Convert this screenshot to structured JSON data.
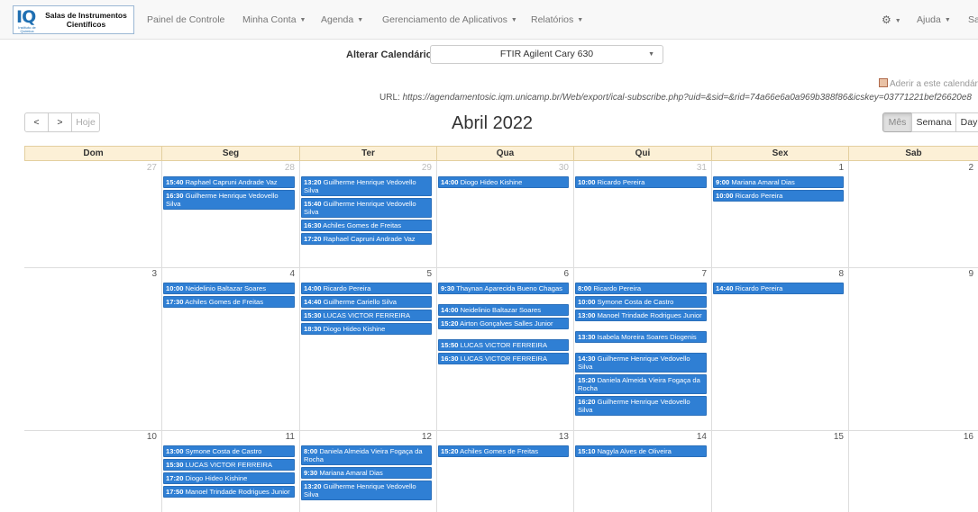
{
  "brand": {
    "title_line1": "Salas de Instrumentos",
    "title_line2": "Científicos",
    "logo_letters": "IQ",
    "logo_sub": "Instituto de Química"
  },
  "nav": {
    "items": [
      {
        "label": "Painel de Controle",
        "caret": false
      },
      {
        "label": "Minha Conta",
        "caret": true
      },
      {
        "label": "Agenda",
        "caret": true
      },
      {
        "label": "Gerenciamento de Aplicativos",
        "caret": true
      },
      {
        "label": "Relatórios",
        "caret": true
      }
    ],
    "help": "Ajuda",
    "right_cut": "Sa"
  },
  "controls": {
    "alter_label": "Alterar Calendário",
    "selected_calendar": "FTIR Agilent Cary 630",
    "subscribe_text": "Aderir a este calendár",
    "url_label": "URL:",
    "url": "https://agendamentosic.iqm.unicamp.br/Web/export/ical-subscribe.php?uid=&sid=&rid=74a66e6a0a969b388f86&icskey=03771221bef26620e8"
  },
  "toolbar": {
    "prev": "<",
    "next": ">",
    "today": "Hoje",
    "month_title": "Abril 2022",
    "views": [
      "Mês",
      "Semana",
      "Day"
    ]
  },
  "calendar": {
    "day_headers": [
      "Dom",
      "Seg",
      "Ter",
      "Qua",
      "Qui",
      "Sex",
      "Sab"
    ],
    "weeks": [
      {
        "days": [
          {
            "num": "27",
            "other": true,
            "events": []
          },
          {
            "num": "28",
            "other": true,
            "events": [
              {
                "time": "15:40",
                "name": "Raphael Capruni Andrade Vaz"
              },
              {
                "time": "16:30",
                "name": "Guilherme Henrique Vedovello Silva"
              }
            ]
          },
          {
            "num": "29",
            "other": true,
            "events": [
              {
                "time": "13:20",
                "name": "Guilherme Henrique Vedovello Silva"
              },
              {
                "time": "15:40",
                "name": "Guilherme Henrique Vedovello Silva"
              },
              {
                "time": "16:30",
                "name": "Achiles Gomes de Freitas"
              },
              {
                "time": "17:20",
                "name": "Raphael Capruni Andrade Vaz"
              }
            ]
          },
          {
            "num": "30",
            "other": true,
            "events": [
              {
                "time": "14:00",
                "name": "Diogo Hideo Kishine"
              }
            ]
          },
          {
            "num": "31",
            "other": true,
            "events": [
              {
                "time": "10:00",
                "name": "Ricardo Pereira"
              }
            ]
          },
          {
            "num": "1",
            "other": false,
            "events": [
              {
                "time": "9:00",
                "name": "Mariana Amaral Dias"
              },
              {
                "time": "10:00",
                "name": "Ricardo Pereira"
              }
            ]
          },
          {
            "num": "2",
            "other": false,
            "events": []
          }
        ]
      },
      {
        "days": [
          {
            "num": "3",
            "other": false,
            "events": []
          },
          {
            "num": "4",
            "other": false,
            "events": [
              {
                "time": "10:00",
                "name": "Neidelinio Baltazar Soares"
              },
              {
                "time": "17:30",
                "name": "Achiles Gomes de Freitas"
              }
            ]
          },
          {
            "num": "5",
            "other": false,
            "events": [
              {
                "time": "14:00",
                "name": "Ricardo Pereira"
              },
              {
                "time": "14:40",
                "name": "Guilherme Cariello Silva"
              },
              {
                "time": "15:30",
                "name": "LUCAS VICTOR FERREIRA"
              },
              {
                "time": "18:30",
                "name": "Diogo Hideo Kishine"
              }
            ]
          },
          {
            "num": "6",
            "other": false,
            "events": [
              {
                "time": "9:30",
                "name": "Thaynan Aparecida Bueno Chagas"
              },
              {
                "time": "14:00",
                "name": "Neidelinio Baltazar Soares"
              },
              {
                "time": "15:20",
                "name": "Airton Gonçalves Salles Junior"
              },
              {
                "time": "15:50",
                "name": "LUCAS VICTOR FERREIRA"
              },
              {
                "time": "16:30",
                "name": "LUCAS VICTOR FERREIRA"
              }
            ]
          },
          {
            "num": "7",
            "other": false,
            "events": [
              {
                "time": "8:00",
                "name": "Ricardo Pereira"
              },
              {
                "time": "10:00",
                "name": "Symone Costa de Castro"
              },
              {
                "time": "13:00",
                "name": "Manoel Trindade Rodrigues Junior"
              },
              {
                "time": "13:30",
                "name": "Isabela Moreira Soares Diogenis"
              },
              {
                "time": "14:30",
                "name": "Guilherme Henrique Vedovello Silva"
              },
              {
                "time": "15:20",
                "name": "Daniela Almeida Vieira Fogaça da Rocha"
              },
              {
                "time": "16:20",
                "name": "Guilherme Henrique Vedovello Silva"
              }
            ]
          },
          {
            "num": "8",
            "other": false,
            "events": [
              {
                "time": "14:40",
                "name": "Ricardo Pereira"
              }
            ]
          },
          {
            "num": "9",
            "other": false,
            "events": []
          }
        ]
      },
      {
        "days": [
          {
            "num": "10",
            "other": false,
            "events": []
          },
          {
            "num": "11",
            "other": false,
            "events": [
              {
                "time": "13:00",
                "name": "Symone Costa de Castro"
              },
              {
                "time": "15:30",
                "name": "LUCAS VICTOR FERREIRA"
              },
              {
                "time": "17:20",
                "name": "Diogo Hideo Kishine"
              },
              {
                "time": "17:50",
                "name": "Manoel Trindade Rodrigues Junior"
              }
            ]
          },
          {
            "num": "12",
            "other": false,
            "events": [
              {
                "time": "8:00",
                "name": "Daniela Almeida Vieira Fogaça da Rocha"
              },
              {
                "time": "9:30",
                "name": "Mariana Amaral Dias"
              },
              {
                "time": "13:20",
                "name": "Guilherme Henrique Vedovello Silva"
              }
            ]
          },
          {
            "num": "13",
            "other": false,
            "events": [
              {
                "time": "15:20",
                "name": "Achiles Gomes de Freitas"
              }
            ]
          },
          {
            "num": "14",
            "other": false,
            "events": [
              {
                "time": "15:10",
                "name": "Nagyla Alves de Oliveira"
              }
            ]
          },
          {
            "num": "15",
            "other": false,
            "events": []
          },
          {
            "num": "16",
            "other": false,
            "events": []
          }
        ]
      }
    ]
  },
  "colors": {
    "event_bg": "#2f7fd4",
    "header_bg": "#fcf0d6"
  }
}
